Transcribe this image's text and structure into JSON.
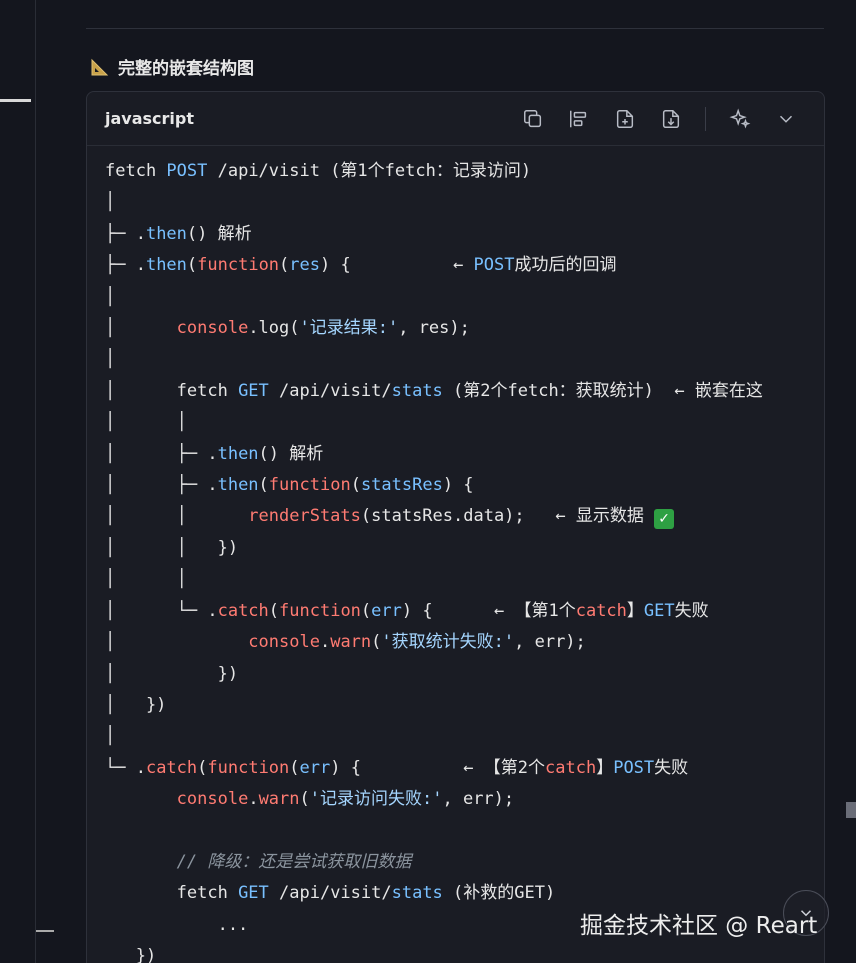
{
  "heading": {
    "title": "完整的嵌套结构图",
    "icon": "ruler-triangle-icon"
  },
  "code_block": {
    "language": "javascript",
    "toolbar": [
      {
        "name": "copy-icon"
      },
      {
        "name": "align-icon"
      },
      {
        "name": "insert-file-icon"
      },
      {
        "name": "export-file-icon"
      },
      {
        "name": "sparkle-icon"
      },
      {
        "name": "chevron-down-icon"
      }
    ],
    "lines": [
      "fetch POST /api/visit (第1个fetch：记录访问)",
      "│",
      "├─ .then() 解析",
      "├─ .then(function(res) {          ← POST成功后的回调",
      "│",
      "│      console.log('记录结果:', res);",
      "│",
      "│      fetch GET /api/visit/stats (第2个fetch：获取统计)  ← 嵌套在这",
      "│      │",
      "│      ├─ .then() 解析",
      "│      ├─ .then(function(statsRes) {",
      "│      │      renderStats(statsRes.data);   ← 显示数据 ✅",
      "│      │   })",
      "│      │",
      "│      └─ .catch(function(err) {      ← 【第1个catch】GET失败",
      "│             console.warn('获取统计失败:', err);",
      "│          })",
      "│   })",
      "│",
      "└─ .catch(function(err) {          ← 【第2个catch】POST失败",
      "       console.warn('记录访问失败:', err);",
      "",
      "       // 降级：还是尝试获取旧数据",
      "       fetch GET /api/visit/stats (补救的GET)",
      "           ...",
      "   })"
    ]
  },
  "watermark": "掘金技术社区 @ Reart"
}
